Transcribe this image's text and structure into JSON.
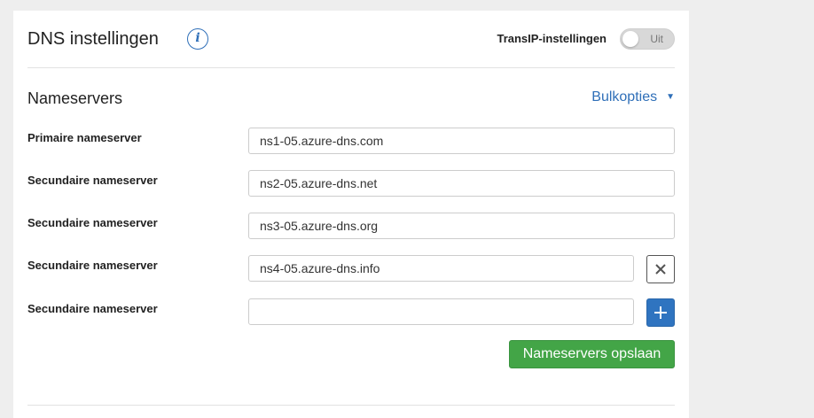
{
  "dns": {
    "title": "DNS instellingen",
    "info_icon": "info-icon",
    "transip_label": "TransIP-instellingen",
    "toggle_state": "Uit"
  },
  "nameservers": {
    "section_title": "Nameservers",
    "bulk_label": "Bulkopties",
    "bulk_caret": "▼",
    "rows": [
      {
        "label": "Primaire nameserver",
        "value": "ns1-05.azure-dns.com"
      },
      {
        "label": "Secundaire nameserver",
        "value": "ns2-05.azure-dns.net"
      },
      {
        "label": "Secundaire nameserver",
        "value": "ns3-05.azure-dns.org"
      },
      {
        "label": "Secundaire nameserver",
        "value": "ns4-05.azure-dns.info"
      },
      {
        "label": "Secundaire nameserver",
        "value": ""
      }
    ],
    "save_label": "Nameservers opslaan"
  },
  "colors": {
    "accent": "#2f6fb8",
    "save": "#43a547",
    "add": "#2f74c0"
  }
}
